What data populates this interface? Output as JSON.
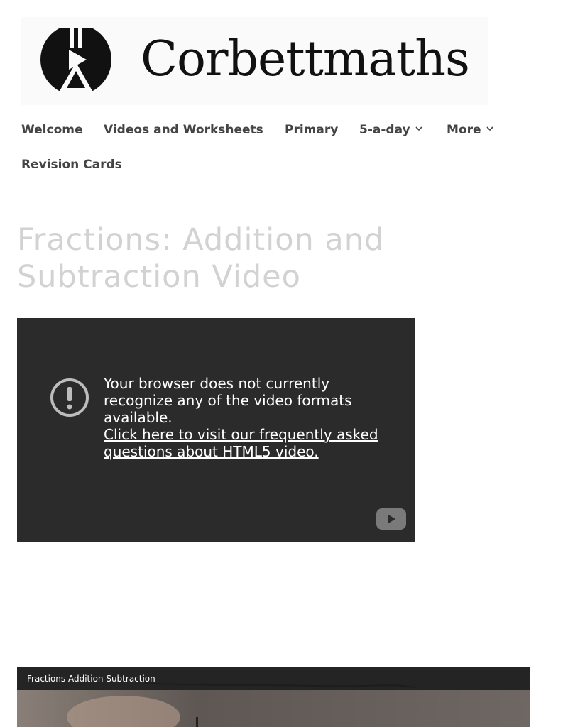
{
  "brand": {
    "name": "Corbettmaths"
  },
  "nav": {
    "items": [
      {
        "label": "Welcome",
        "has_dropdown": false
      },
      {
        "label": "Videos and Worksheets",
        "has_dropdown": false
      },
      {
        "label": "Primary",
        "has_dropdown": false
      },
      {
        "label": "5-a-day",
        "has_dropdown": true
      },
      {
        "label": "More",
        "has_dropdown": true
      },
      {
        "label": "Revision Cards",
        "has_dropdown": false
      }
    ]
  },
  "page": {
    "title": "Fractions: Addition and Subtraction Video"
  },
  "player": {
    "error_message": "Your browser does not currently recognize any of the video formats available.",
    "faq_link": "Click here to visit our frequently asked questions about HTML5 video."
  },
  "video2": {
    "title": "Fractions Addition Subtraction"
  },
  "colors": {
    "title_grey": "#d2d2d2",
    "nav_text": "#444444",
    "player_bg": "#2b2b2b"
  },
  "icons": [
    "logo-mark-icon",
    "chevron-down-icon",
    "exclamation-circle-icon",
    "youtube-icon"
  ]
}
